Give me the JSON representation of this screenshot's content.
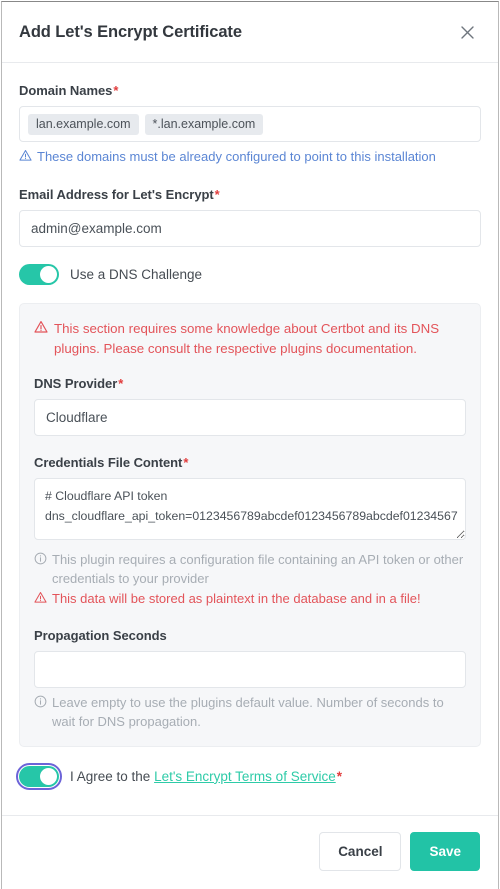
{
  "dialog": {
    "title": "Add Let's Encrypt Certificate",
    "close_icon": "close-icon"
  },
  "domain_names": {
    "label": "Domain Names",
    "required_mark": "*",
    "tags": [
      "lan.example.com",
      "*.lan.example.com"
    ],
    "hint": "These domains must be already configured to point to this installation"
  },
  "email": {
    "label": "Email Address for Let's Encrypt",
    "required_mark": "*",
    "value": "admin@example.com",
    "placeholder": "admin@example.com"
  },
  "dns_challenge_toggle": {
    "label": "Use a DNS Challenge",
    "state": "on"
  },
  "dns_panel": {
    "warning": "This section requires some knowledge about Certbot and its DNS plugins. Please consult the respective plugins documentation.",
    "provider": {
      "label": "DNS Provider",
      "required_mark": "*",
      "value": "Cloudflare",
      "placeholder": "Cloudflare"
    },
    "credentials": {
      "label": "Credentials File Content",
      "required_mark": "*",
      "value": "# Cloudflare API token\ndns_cloudflare_api_token=0123456789abcdef0123456789abcdef01234567",
      "info": "This plugin requires a configuration file containing an API token or other credentials to your provider",
      "warning": "This data will be stored as plaintext in the database and in a file!"
    },
    "propagation": {
      "label": "Propagation Seconds",
      "value": "",
      "placeholder": "",
      "info": "Leave empty to use the plugins default value. Number of seconds to wait for DNS propagation."
    }
  },
  "terms": {
    "prefix": "I Agree to the ",
    "link": "Let's Encrypt Terms of Service",
    "required_mark": "*",
    "state": "on"
  },
  "footer": {
    "cancel_label": "Cancel",
    "save_label": "Save"
  },
  "colors": {
    "accent_teal": "#22c3a6",
    "toggle_on": "#26c6a8",
    "danger_red": "#e3545a",
    "required_red": "#e13c3c",
    "info_blue": "#5b86d4",
    "muted_gray": "#a7adb4",
    "panel_bg": "#f6f7f9",
    "focus_ring": "#6c63d8"
  }
}
